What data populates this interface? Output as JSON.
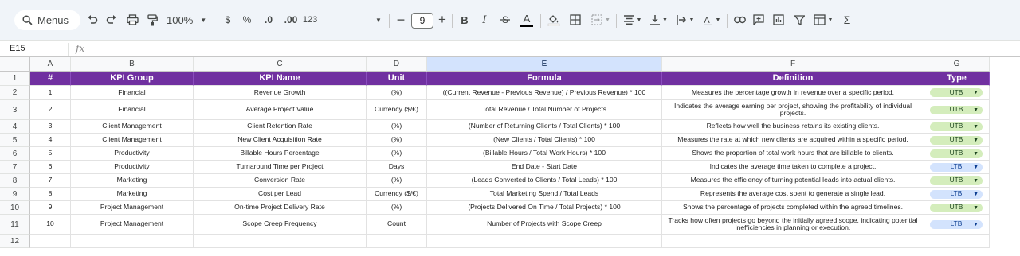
{
  "toolbar": {
    "menus_label": "Menus",
    "zoom": "100%",
    "currency_symbol": "$",
    "percent_symbol": "%",
    "decrease_decimal": ".0",
    "increase_decimal": ".00",
    "number_format": "123",
    "font_size": "9",
    "bold": "B",
    "italic": "I",
    "text_color": "A",
    "sum_symbol": "Σ"
  },
  "formula_bar": {
    "cell_ref": "E15",
    "fx_label": "fx"
  },
  "columns": [
    "A",
    "B",
    "C",
    "D",
    "E",
    "F",
    "G"
  ],
  "rows": [
    "1",
    "2",
    "3",
    "4",
    "5",
    "6",
    "7",
    "8",
    "9",
    "10",
    "11",
    "12"
  ],
  "table": {
    "headers": [
      "#",
      "KPI Group",
      "KPI Name",
      "Unit",
      "Formula",
      "Definition",
      "Type"
    ],
    "data": [
      [
        "1",
        "Financial",
        "Revenue Growth",
        "(%)",
        "((Current Revenue - Previous Revenue) / Previous Revenue) * 100",
        "Measures the percentage growth in revenue over a specific period.",
        "UTB"
      ],
      [
        "2",
        "Financial",
        "Average Project Value",
        "Currency ($/€)",
        "Total Revenue / Total Number of Projects",
        "Indicates the average earning per project, showing the profitability of individual projects.",
        "UTB"
      ],
      [
        "3",
        "Client Management",
        "Client Retention Rate",
        "(%)",
        "(Number of Returning Clients / Total Clients) * 100",
        "Reflects how well the business retains its existing clients.",
        "UTB"
      ],
      [
        "4",
        "Client Management",
        "New Client Acquisition Rate",
        "(%)",
        "(New Clients / Total Clients) * 100",
        "Measures the rate at which new clients are acquired within a specific period.",
        "UTB"
      ],
      [
        "5",
        "Productivity",
        "Billable Hours Percentage",
        "(%)",
        "(Billable Hours / Total Work Hours) * 100",
        "Shows the proportion of total work hours that are billable to clients.",
        "UTB"
      ],
      [
        "6",
        "Productivity",
        "Turnaround Time per Project",
        "Days",
        "End Date - Start Date",
        "Indicates the average time taken to complete a project.",
        "LTB"
      ],
      [
        "7",
        "Marketing",
        "Conversion Rate",
        "(%)",
        "(Leads Converted to Clients / Total Leads) * 100",
        "Measures the efficiency of turning potential leads into actual clients.",
        "UTB"
      ],
      [
        "8",
        "Marketing",
        "Cost per Lead",
        "Currency ($/€)",
        "Total Marketing Spend / Total Leads",
        "Represents the average cost spent to generate a single lead.",
        "LTB"
      ],
      [
        "9",
        "Project Management",
        "On-time Project Delivery Rate",
        "(%)",
        "(Projects Delivered On Time / Total Projects) * 100",
        "Shows the percentage of projects completed within the agreed timelines.",
        "UTB"
      ],
      [
        "10",
        "Project Management",
        "Scope Creep Frequency",
        "Count",
        "Number of Projects with Scope Creep",
        "Tracks how often projects go beyond the initially agreed scope, indicating potential inefficiencies in planning or execution.",
        "LTB"
      ]
    ]
  },
  "colors": {
    "header_bg": "#7030a0",
    "utb_chip": "#d4edbc",
    "ltb_chip": "#d3e3fd",
    "selected_col": "#d3e3fd"
  }
}
